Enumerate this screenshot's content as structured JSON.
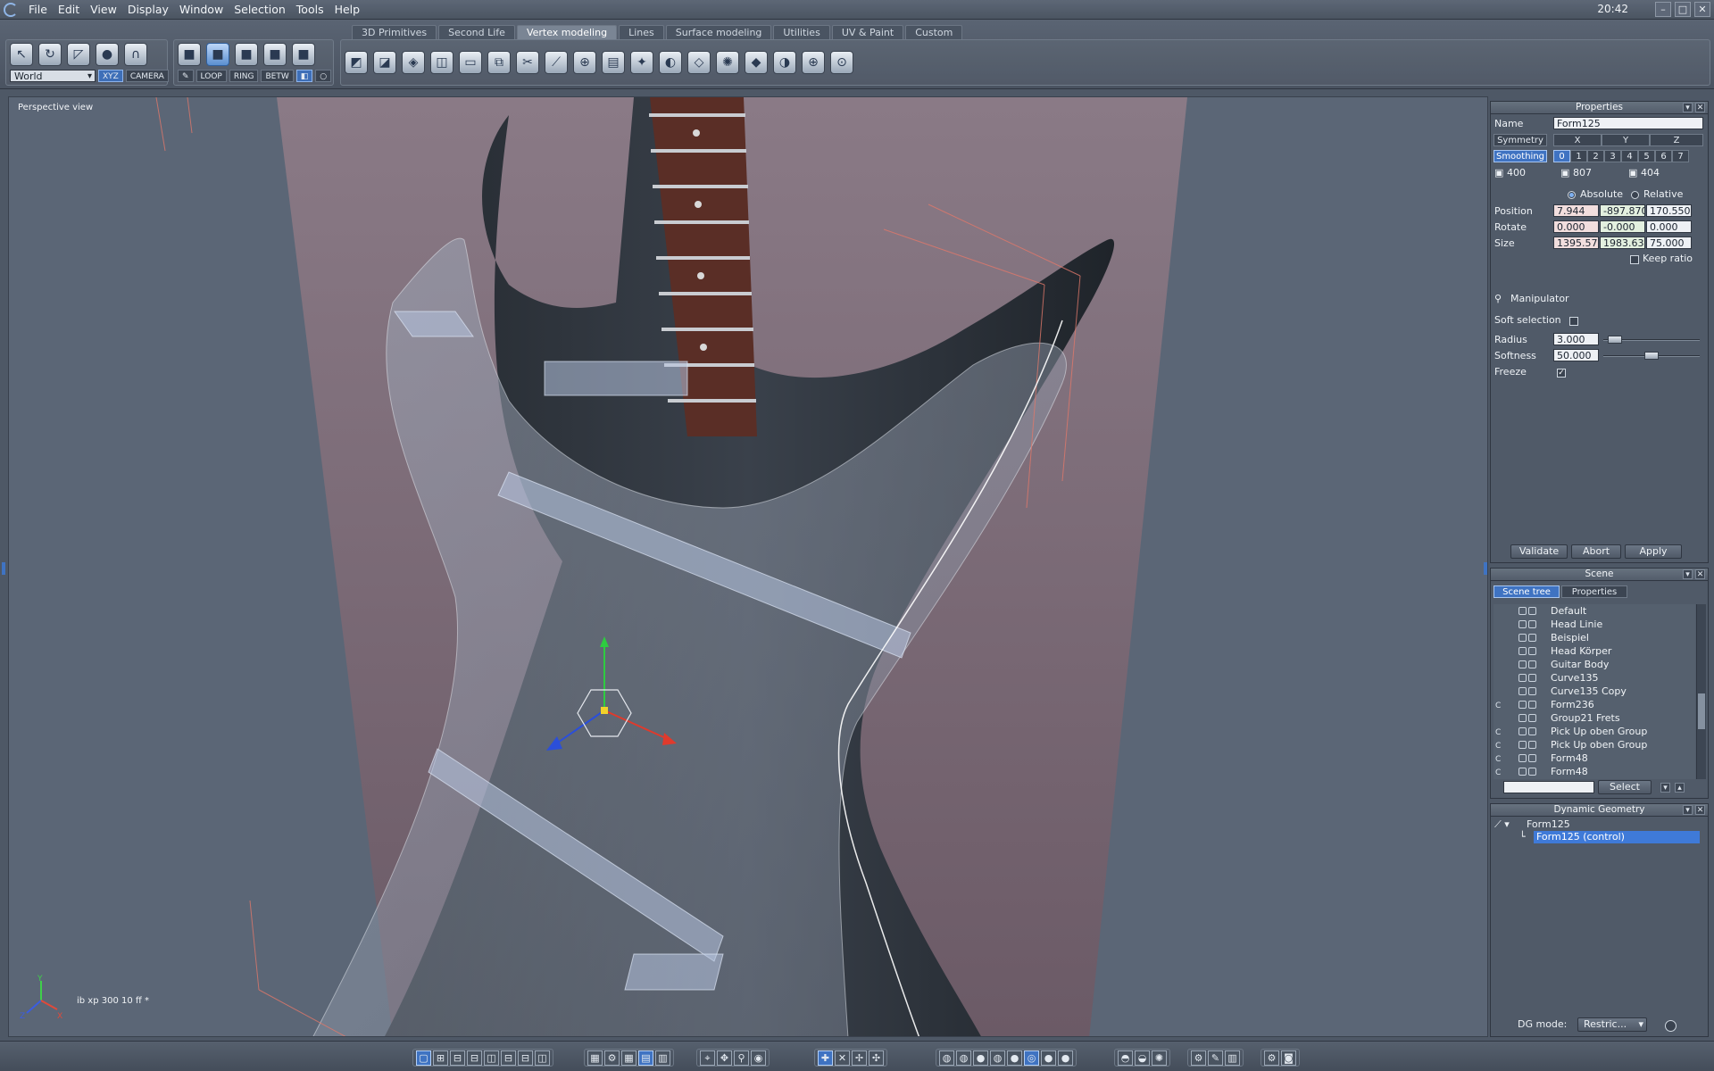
{
  "menubar": {
    "items": [
      "File",
      "Edit",
      "View",
      "Display",
      "Window",
      "Selection",
      "Tools",
      "Help"
    ],
    "clock": "20:42"
  },
  "toolbar": {
    "tabs": [
      "3D Primitives",
      "Second Life",
      "Vertex modeling",
      "Lines",
      "Surface modeling",
      "Utilities",
      "UV & Paint",
      "Custom"
    ],
    "active_tab": "Vertex modeling",
    "space_select": "World",
    "xyz_label": "XYZ",
    "camera_label": "CAMERA",
    "loop_label": "LOOP",
    "ring_label": "RING",
    "betw_label": "BETW"
  },
  "viewport": {
    "label": "Perspective view",
    "stats": "ib xp 300 10 ff *",
    "axis_labels": [
      "Y",
      "Z",
      "X"
    ]
  },
  "properties": {
    "title": "Properties",
    "name_label": "Name",
    "name_value": "Form125",
    "symmetry_label": "Symmetry",
    "symmetry_axes": [
      "X",
      "Y",
      "Z"
    ],
    "smoothing_label": "Smoothing",
    "smoothing_levels": [
      "0",
      "1",
      "2",
      "3",
      "4",
      "5",
      "6",
      "7"
    ],
    "counts": [
      "400",
      "807",
      "404"
    ],
    "absolute_label": "Absolute",
    "relative_label": "Relative",
    "position_label": "Position",
    "position": [
      "7.944",
      "-897.870",
      "170.550"
    ],
    "rotate_label": "Rotate",
    "rotate": [
      "0.000",
      "-0.000",
      "0.000"
    ],
    "size_label": "Size",
    "size": [
      "1395.57",
      "1983.63",
      "75.000"
    ],
    "keep_ratio_label": "Keep ratio",
    "manipulator_label": "Manipulator",
    "soft_selection_label": "Soft selection",
    "radius_label": "Radius",
    "radius_value": "3.000",
    "radius_level": 0.05,
    "softness_label": "Softness",
    "softness_value": "50.000",
    "softness_level": 0.5,
    "freeze_label": "Freeze",
    "validate_label": "Validate",
    "abort_label": "Abort",
    "apply_label": "Apply"
  },
  "scene": {
    "title": "Scene",
    "tab_tree": "Scene tree",
    "tab_properties": "Properties",
    "items": [
      "Default",
      "Head Linie",
      "Beispiel",
      "Head Körper",
      "Guitar Body",
      "Curve135",
      "Curve135 Copy",
      "Form236",
      "Group21 Frets",
      "Pick Up oben Group",
      "Pick Up oben Group",
      "Form48",
      "Form48"
    ],
    "select_label": "Select"
  },
  "dynamic_geometry": {
    "title": "Dynamic Geometry",
    "root": "Form125",
    "child": "Form125 (control)",
    "mode_label": "DG mode:",
    "mode_value": "Restric..."
  },
  "colors": {
    "accent": "#3f7ad8",
    "viewport_bg": "#5b6676",
    "guitar_body": "#2a2f37",
    "fretboard": "#5a2e26"
  }
}
